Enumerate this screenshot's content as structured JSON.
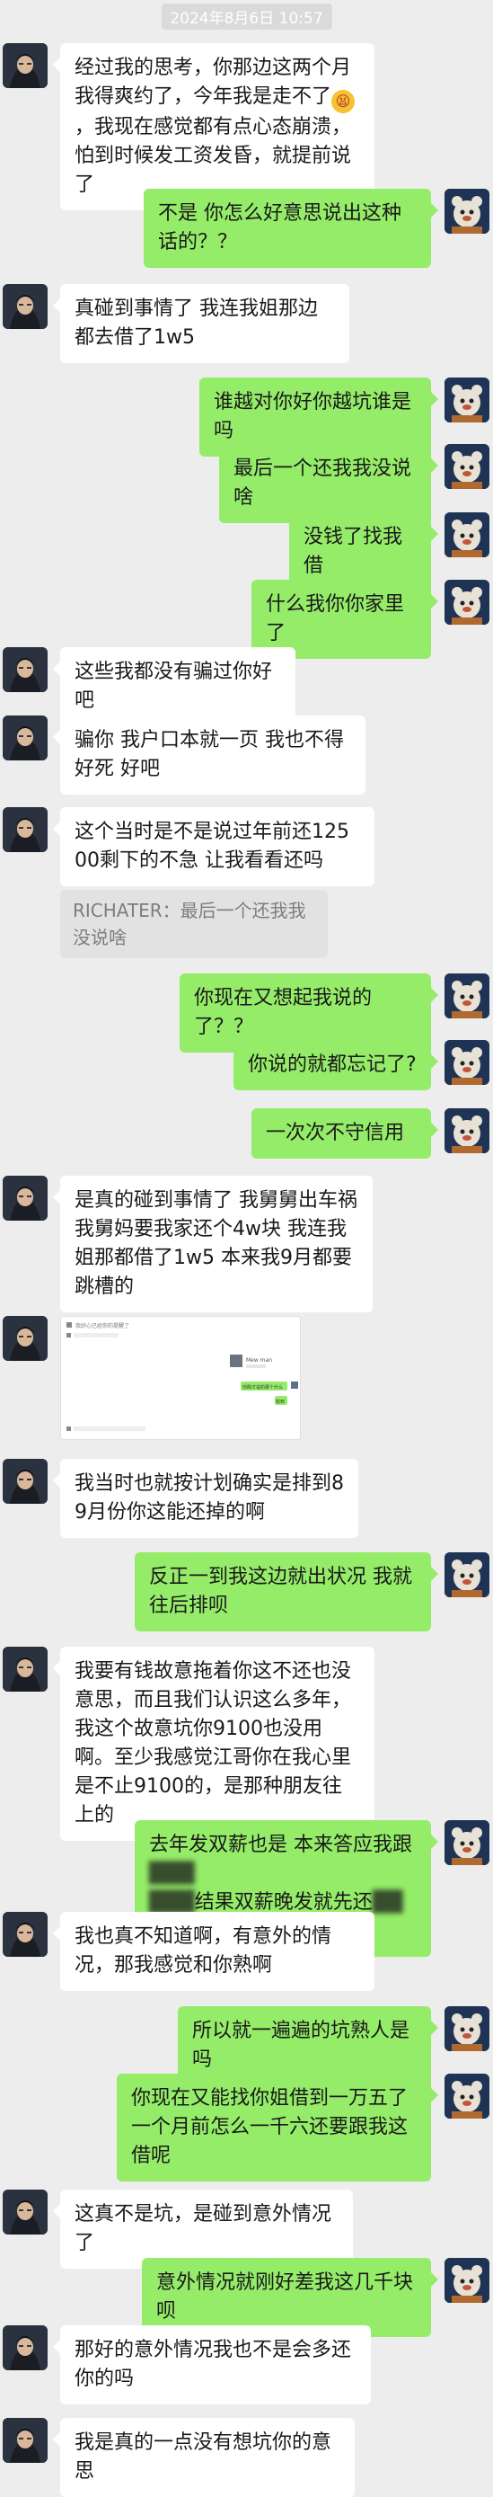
{
  "timestamp": "2024年8月6日 10:57",
  "avatars": {
    "other": "anime-character-avatar",
    "self": "cartoon-mascot-avatar"
  },
  "colors": {
    "background": "#ededed",
    "incoming_bubble": "#ffffff",
    "outgoing_bubble": "#95ec69",
    "quote": "#e2e2e2"
  },
  "messages": [
    {
      "from": "other",
      "text": "经过我的思考，你那边这两个月我得爽约了，今年我是走不了",
      "emoji": "tired-face-emoji",
      "text2": "，我现在感觉都有点心态崩溃，怕到时候发工资发昏，就提前说了"
    },
    {
      "from": "self",
      "text": "不是 你怎么好意思说出这种话的？？"
    },
    {
      "from": "other",
      "text": "真碰到事情了 我连我姐那边都去借了1w5"
    },
    {
      "from": "self",
      "text": "谁越对你好你越坑谁是吗"
    },
    {
      "from": "self",
      "text": "最后一个还我我没说啥"
    },
    {
      "from": "self",
      "text": "没钱了找我借"
    },
    {
      "from": "self",
      "text": "什么我你你家里了"
    },
    {
      "from": "other",
      "text": "这些我都没有骗过你好吧"
    },
    {
      "from": "other",
      "text": "骗你 我户口本就一页 我也不得好死 好吧"
    },
    {
      "from": "other",
      "text": "这个当时是不是说过年前还12500剩下的不急 让我看看还吗"
    },
    {
      "from": "quote",
      "text": "RICHATER：最后一个还我我没说啥"
    },
    {
      "from": "self",
      "text": "你现在又想起我说的了？？"
    },
    {
      "from": "self",
      "text": "你说的就都忘记了?"
    },
    {
      "from": "self",
      "text": "一次次不守信用"
    },
    {
      "from": "other",
      "text": "是真的碰到事情了 我舅舅出车祸 我舅妈要我家还个4w块 我连我姐那都借了1w5 本来我9月都要跳槽的"
    },
    {
      "from": "other",
      "image": "chat-screenshot-image"
    },
    {
      "from": "other",
      "text": "我当时也就按计划确实是排到8 9月份你这能还掉的啊"
    },
    {
      "from": "self",
      "text": "反正一到我这边就出状况 我就往后排呗"
    },
    {
      "from": "other",
      "text": "我要有钱故意拖着你这不还也没意思，而且我们认识这么多年，我这个故意坑你9100也没用啊。至少我感觉江哥你在我心里是不止9100的，是那种朋友往上的"
    },
    {
      "from": "self",
      "text": "去年发双薪也是 本来答应我跟",
      "blurred": "███",
      "text2": "",
      "blurred2": "███",
      "text3": "结果双薪晚发就先还",
      "blurred3": "███"
    },
    {
      "from": "other",
      "text": "我也真不知道啊，有意外的情况，那我感觉和你熟啊"
    },
    {
      "from": "self",
      "text": "所以就一遍遍的坑熟人是吗"
    },
    {
      "from": "self",
      "text": "你现在又能找你姐借到一万五了 一个月前怎么一千六还要跟我这借呢"
    },
    {
      "from": "other",
      "text": "这真不是坑，是碰到意外情况了"
    },
    {
      "from": "self",
      "text": "意外情况就刚好差我这几千块呗"
    },
    {
      "from": "other",
      "text": "那好的意外情况我也不是会多还你的吗"
    },
    {
      "from": "other",
      "text": "我是真的一点没有想坑你的意思"
    }
  ],
  "image_preview": {
    "top_line": "我好心已经你的提醒了",
    "bubble_name": "Mew man",
    "green_line": "你刚才说的那个什么",
    "green_short": "收到"
  }
}
